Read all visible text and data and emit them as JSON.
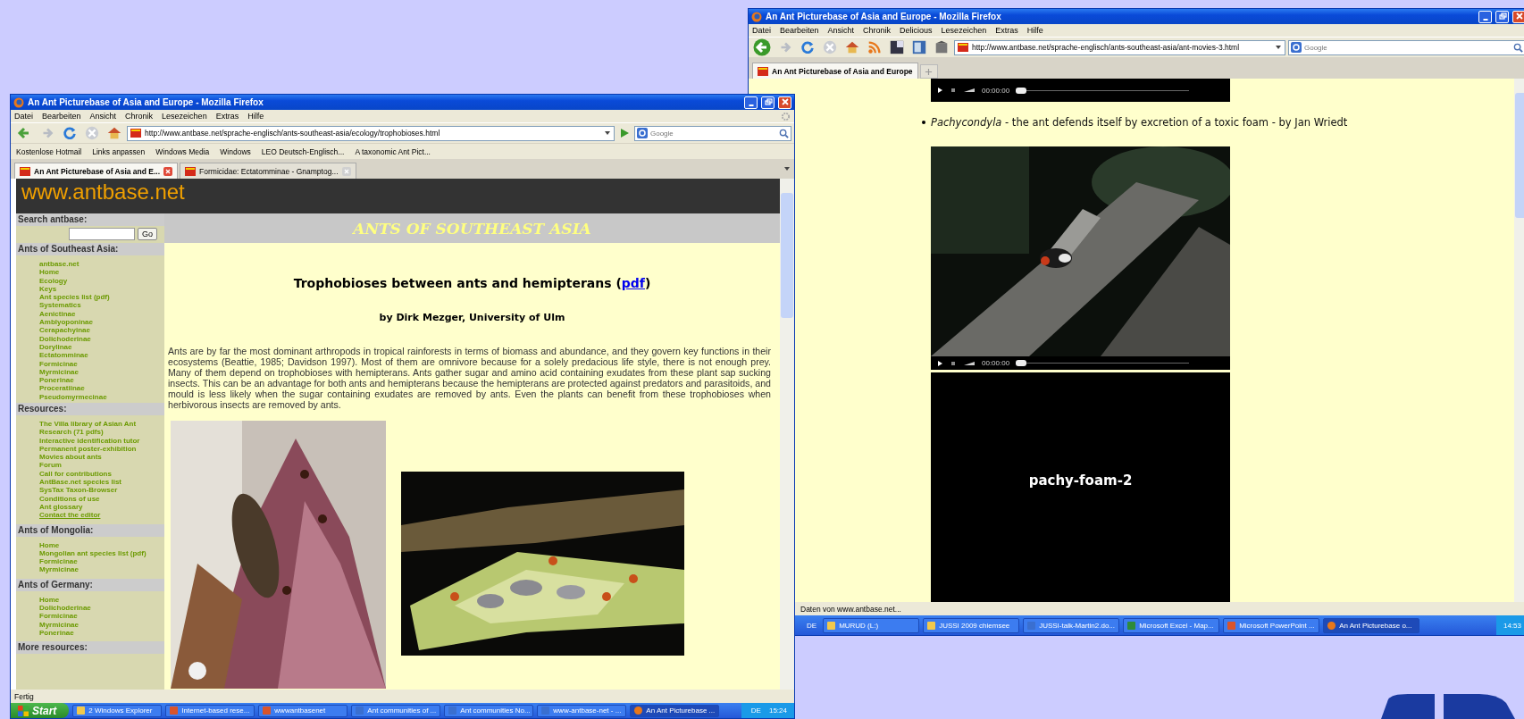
{
  "windows": [
    {
      "kind": "article",
      "title": "An Ant Picturebase of Asia and Europe - Mozilla Firefox",
      "menu": [
        "Datei",
        "Bearbeiten",
        "Ansicht",
        "Chronik",
        "Lesezeichen",
        "Extras",
        "Hilfe"
      ],
      "address": "http://www.antbase.net/sprache-englisch/ants-southeast-asia/ecology/trophobioses.html",
      "search_placeholder": "Google",
      "bookmarks": [
        "Kostenlose Hotmail",
        "Links anpassen",
        "Windows Media",
        "Windows",
        "LEO Deutsch-Englisch...",
        "A taxonomic Ant Pict..."
      ],
      "tabs": [
        {
          "label": "An Ant Picturebase of Asia and E...",
          "selected": true
        },
        {
          "label": "Formicidae: Ectatomminae - Gnamptog...",
          "selected": false
        }
      ],
      "page": {
        "site_name": "www.antbase.net",
        "search_label": "Search antbase:",
        "search_button": "Go",
        "banner": "ANTS OF SOUTHEAST ASIA",
        "sections": [
          {
            "heading": "Ants of Southeast Asia:",
            "links": [
              {
                "label": "antbase.net",
                "hovered": false
              },
              {
                "label": "Home",
                "hovered": false
              },
              {
                "label": "Ecology",
                "hovered": false
              },
              {
                "label": "Keys",
                "hovered": false
              },
              {
                "label": "Ant species list (pdf)",
                "hovered": false
              },
              {
                "label": "Systematics",
                "hovered": false
              },
              {
                "label": "Aenictinae",
                "hovered": false
              },
              {
                "label": "Amblyoponinae",
                "hovered": false
              },
              {
                "label": "Cerapachyinae",
                "hovered": false
              },
              {
                "label": "Dolichoderinae",
                "hovered": false
              },
              {
                "label": "Dorylinae",
                "hovered": false
              },
              {
                "label": "Ectatomminae",
                "hovered": false
              },
              {
                "label": "Formicinae",
                "hovered": false
              },
              {
                "label": "Myrmicinae",
                "hovered": false
              },
              {
                "label": "Ponerinae",
                "hovered": false
              },
              {
                "label": "Proceratiinae",
                "hovered": false
              },
              {
                "label": "Pseudomyrmecinae",
                "hovered": false
              }
            ]
          },
          {
            "heading": "Resources:",
            "links": [
              {
                "label": "The Villa library of Asian Ant Research (71 pdfs)",
                "hovered": false
              },
              {
                "label": "Interactive identification tutor",
                "hovered": false
              },
              {
                "label": "Permanent poster-exhibition",
                "hovered": false
              },
              {
                "label": "Movies about ants",
                "hovered": false
              },
              {
                "label": "Forum",
                "hovered": false
              },
              {
                "label": "Call for contributions",
                "hovered": false
              },
              {
                "label": "AntBase.net species list",
                "hovered": false
              },
              {
                "label": "SysTax Taxon-Browser",
                "hovered": false
              },
              {
                "label": "Conditions of use",
                "hovered": false
              },
              {
                "label": "Ant glossary",
                "hovered": false
              },
              {
                "label": "Contact the editor",
                "hovered": true
              }
            ]
          },
          {
            "heading": "Ants of Mongolia:",
            "links": [
              {
                "label": "Home",
                "hovered": false
              },
              {
                "label": "Mongolian ant species list (pdf)",
                "hovered": false
              },
              {
                "label": "Formicinae",
                "hovered": false
              },
              {
                "label": "Myrmicinae",
                "hovered": false
              }
            ]
          },
          {
            "heading": "Ants of Germany:",
            "links": [
              {
                "label": "Home",
                "hovered": false
              },
              {
                "label": "Dolichoderinae",
                "hovered": false
              },
              {
                "label": "Formicinae",
                "hovered": false
              },
              {
                "label": "Myrmicinae",
                "hovered": false
              },
              {
                "label": "Ponerinae",
                "hovered": false
              }
            ]
          },
          {
            "heading": "More resources:"
          }
        ],
        "title_before": "Trophobioses between ants and hemipterans (",
        "title_link": "pdf",
        "title_after": ")",
        "byline": "by Dirk Mezger, University of Ulm",
        "paragraph": "Ants are by far the most dominant arthropods in tropical rainforests in terms of biomass and abundance, and they govern key functions in their ecosystems (Beattie, 1985; Davidson 1997). Most of them are omnivore because for a solely predacious life style, there is not enough prey. Many of them depend on trophobioses with hemipterans. Ants gather sugar and amino acid containing exudates from these plant sap sucking insects. This can be an advantage for both ants and hemipterans because the hemipterans are protected against predators and parasitoids, and mould is less likely when the sugar containing exudates are removed by ants. Even the plants can benefit from these trophobioses when herbivorous insects are removed by ants."
      },
      "status": "Fertig",
      "taskbar": {
        "start": "Start",
        "items": [
          {
            "label": "2 Windows Explorer",
            "kind": "folder",
            "selected": false
          },
          {
            "label": "Internet-based rese...",
            "kind": "powerpoint",
            "selected": false
          },
          {
            "label": "wwwantbasenet",
            "kind": "powerpoint",
            "selected": false
          },
          {
            "label": "Ant communities of ...",
            "kind": "word",
            "selected": false
          },
          {
            "label": "Ant communities No...",
            "kind": "word",
            "selected": false
          },
          {
            "label": "www-antbase-net - ...",
            "kind": "word",
            "selected": false
          },
          {
            "label": "An Ant Picturebase ...",
            "kind": "firefox",
            "selected": true
          }
        ],
        "lang": "DE",
        "clock": "15:24"
      }
    },
    {
      "kind": "movies",
      "title": "An Ant Picturebase of Asia and Europe - Mozilla Firefox",
      "menu": [
        "Datei",
        "Bearbeiten",
        "Ansicht",
        "Chronik",
        "Delicious",
        "Lesezeichen",
        "Extras",
        "Hilfe"
      ],
      "address": "http://www.antbase.net/sprache-englisch/ants-southeast-asia/ant-movies-3.html",
      "search_placeholder": "Google",
      "tabs": [
        {
          "label": "An Ant Picturebase of Asia and Europe",
          "selected": true
        }
      ],
      "page": {
        "player_time": "00:00:00",
        "item": "*Pachycondyla* - the ant defends itself by excretion of a toxic foam - by Jan Wriedt",
        "video_time": "00:00:00",
        "next_video": "pachy-foam-2"
      },
      "status": "Daten von www.antbase.net...",
      "taskbar": {
        "lang": "DE",
        "items": [
          {
            "label": "MURUD (L:)",
            "kind": "folder",
            "selected": false
          },
          {
            "label": "JUSSI 2009 chiemsee",
            "kind": "folder",
            "selected": false
          },
          {
            "label": "JUSSI-talk-Martin2.do...",
            "kind": "word",
            "selected": false
          },
          {
            "label": "Microsoft Excel - Map...",
            "kind": "excel",
            "selected": false
          },
          {
            "label": "Microsoft PowerPoint ...",
            "kind": "powerpoint",
            "selected": false
          },
          {
            "label": "An Ant Picturebase o...",
            "kind": "firefox",
            "selected": true
          }
        ],
        "clock": "14:53"
      }
    }
  ]
}
